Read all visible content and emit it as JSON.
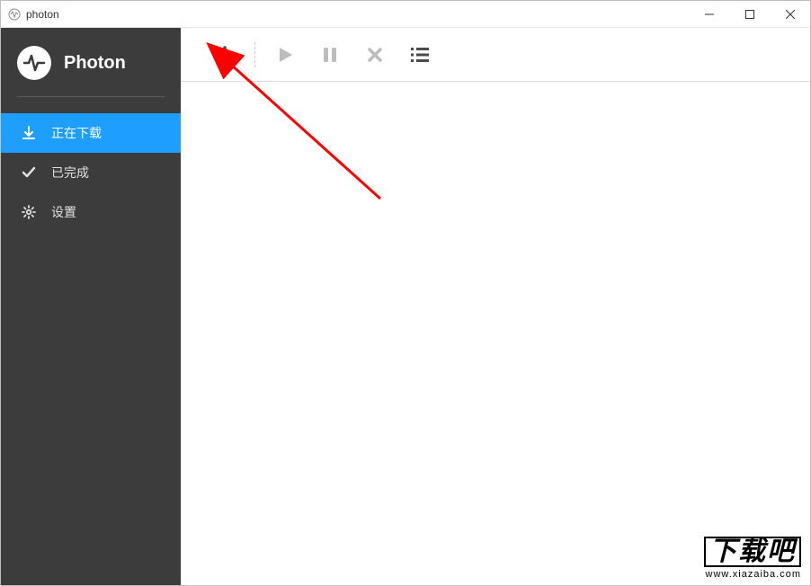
{
  "window": {
    "title": "photon"
  },
  "sidebar": {
    "brand": "Photon",
    "items": [
      {
        "label": "正在下载"
      },
      {
        "label": "已完成"
      },
      {
        "label": "设置"
      }
    ]
  },
  "watermark": {
    "big": "下载吧",
    "small": "www.xiazaiba.com"
  }
}
